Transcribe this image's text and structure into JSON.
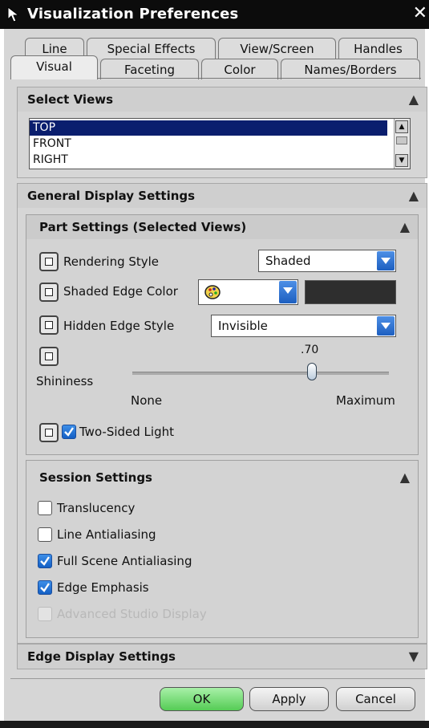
{
  "window": {
    "title": "Visualization Preferences",
    "close_glyph": "✕"
  },
  "tabs_row1": [
    "Line",
    "Special Effects",
    "View/Screen",
    "Handles"
  ],
  "tabs_row2": [
    "Visual",
    "Faceting",
    "Color",
    "Names/Borders"
  ],
  "active_tab": "Visual",
  "select_views": {
    "heading": "Select Views",
    "items": [
      "TOP",
      "FRONT",
      "RIGHT"
    ],
    "selected": "TOP"
  },
  "general": {
    "heading": "General Display Settings",
    "part_settings": {
      "heading": "Part Settings (Selected Views)",
      "rendering_style_label": "Rendering Style",
      "rendering_style_value": "Shaded",
      "shaded_edge_color_label": "Shaded Edge Color",
      "shaded_edge_color_swatch": "#2e2e2e",
      "hidden_edge_style_label": "Hidden Edge Style",
      "hidden_edge_style_value": "Invisible",
      "shininess_label": "Shininess",
      "shininess_value": ".70",
      "shininess_fraction": 0.7,
      "shininess_min": "None",
      "shininess_max": "Maximum",
      "two_sided_light_label": "Two-Sided Light",
      "two_sided_light_checked": true
    },
    "session_settings": {
      "heading": "Session Settings",
      "options": [
        {
          "label": "Translucency",
          "checked": false,
          "disabled": false
        },
        {
          "label": "Line Antialiasing",
          "checked": false,
          "disabled": false
        },
        {
          "label": "Full Scene Antialiasing",
          "checked": true,
          "disabled": false
        },
        {
          "label": "Edge Emphasis",
          "checked": true,
          "disabled": false
        },
        {
          "label": "Advanced Studio Display",
          "checked": false,
          "disabled": true
        }
      ]
    }
  },
  "edge_display": {
    "heading": "Edge Display Settings"
  },
  "buttons": {
    "ok": "OK",
    "apply": "Apply",
    "cancel": "Cancel"
  },
  "colors": {
    "title_bar": "#0c0c0c",
    "selection": "#0a1e6e",
    "ok_button": "#55cc55",
    "check_on": "#135fc4"
  }
}
